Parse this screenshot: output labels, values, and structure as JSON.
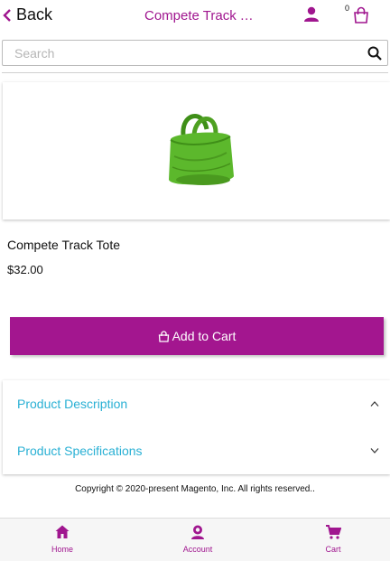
{
  "header": {
    "back_label": "Back",
    "title": "Compete Track Tote",
    "cart_count": "0"
  },
  "search": {
    "placeholder": "Search",
    "value": ""
  },
  "product": {
    "name": "Compete Track Tote",
    "price": "$32.00",
    "image_icon": "green-tote-bag"
  },
  "actions": {
    "add_to_cart_label": "Add to Cart"
  },
  "accordion": [
    {
      "label": "Product Description",
      "state": "expanded"
    },
    {
      "label": "Product Specifications",
      "state": "collapsed"
    }
  ],
  "footer": {
    "copyright": "Copyright © 2020-present Magento, Inc. All rights reserved.."
  },
  "bottom_nav": [
    {
      "label": "Home",
      "icon": "home-icon"
    },
    {
      "label": "Account",
      "icon": "account-icon"
    },
    {
      "label": "Cart",
      "icon": "cart-icon"
    }
  ],
  "colors": {
    "brand": "#a3168f",
    "link": "#29b0d4",
    "product_green": "#5cb82c"
  }
}
